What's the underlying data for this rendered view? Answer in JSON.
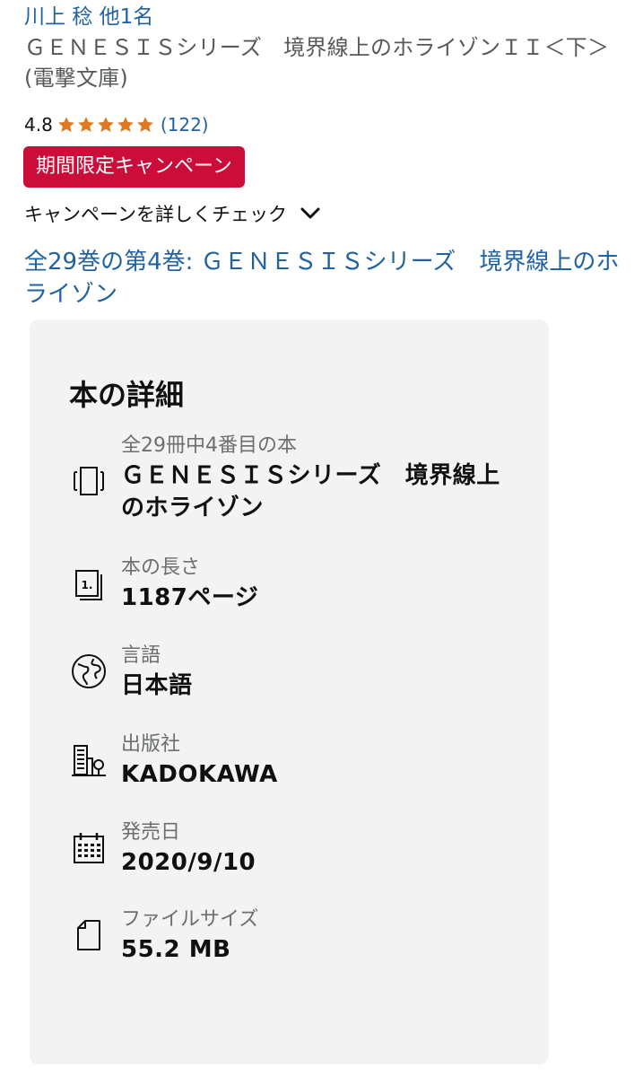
{
  "header": {
    "author": "川上 稔 他1名",
    "title": "ＧＥＮＥＳＩＳシリーズ　境界線上のホライゾンＩＩ＜下＞ (電撃文庫)",
    "rating_value": "4.8",
    "rating_stars": 5,
    "review_count": "(122)",
    "deal_badge": "期間限定キャンペーン",
    "campaign_check": "キャンペーンを詳しくチェック",
    "series_link": "全29巻の第4巻: ＧＥＮＥＳＩＳシリーズ　境界線上のホライゾン"
  },
  "details": {
    "heading": "本の詳細",
    "items": [
      {
        "icon": "series-books-icon",
        "label": "全29冊中4番目の本",
        "value": "ＧＥＮＥＳＩＳシリーズ　境界線上のホライゾン"
      },
      {
        "icon": "page-count-icon",
        "label": "本の長さ",
        "value": "1187ページ"
      },
      {
        "icon": "globe-icon",
        "label": "言語",
        "value": "日本語"
      },
      {
        "icon": "building-icon",
        "label": "出版社",
        "value": "KADOKAWA"
      },
      {
        "icon": "calendar-icon",
        "label": "発売日",
        "value": "2020/9/10"
      },
      {
        "icon": "file-icon",
        "label": "ファイルサイズ",
        "value": "55.2 MB"
      }
    ]
  },
  "colors": {
    "link": "#2162a1",
    "star": "#de7921",
    "deal_badge": "#cc0c39",
    "card_background": "#f3f3f3"
  }
}
